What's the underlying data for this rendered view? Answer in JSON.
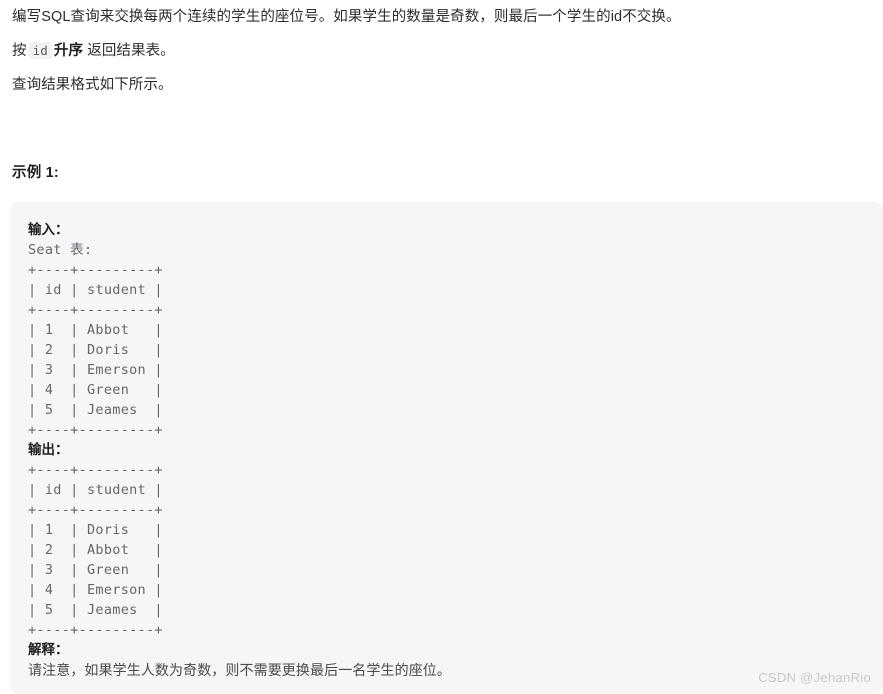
{
  "problem": {
    "paragraph_1": "编写SQL查询来交换每两个连续的学生的座位号。如果学生的数量是奇数，则最后一个学生的id不交换。",
    "paragraph_2": {
      "prefix": "按",
      "code": "id",
      "emphasis": "升序",
      "suffix": "返回结果表。"
    },
    "paragraph_3": "查询结果格式如下所示。"
  },
  "example": {
    "heading": "示例 1:",
    "input_label": "输入：",
    "input_table_caption": "Seat 表:",
    "input_table_text": "+----+---------+\n| id | student |\n+----+---------+\n| 1  | Abbot   |\n| 2  | Doris   |\n| 3  | Emerson |\n| 4  | Green   |\n| 5  | Jeames  |\n+----+---------+",
    "output_label": "输出：",
    "output_table_text": "+----+---------+\n| id | student |\n+----+---------+\n| 1  | Doris   |\n| 2  | Abbot   |\n| 3  | Green   |\n| 4  | Emerson |\n| 5  | Jeames  |\n+----+---------+",
    "explain_label": "解释：",
    "explain_text": "请注意，如果学生人数为奇数，则不需要更换最后一名学生的座位。",
    "input_table": {
      "columns": [
        "id",
        "student"
      ],
      "rows": [
        [
          "1",
          "Abbot"
        ],
        [
          "2",
          "Doris"
        ],
        [
          "3",
          "Emerson"
        ],
        [
          "4",
          "Green"
        ],
        [
          "5",
          "Jeames"
        ]
      ]
    },
    "output_table": {
      "columns": [
        "id",
        "student"
      ],
      "rows": [
        [
          "1",
          "Doris"
        ],
        [
          "2",
          "Abbot"
        ],
        [
          "3",
          "Green"
        ],
        [
          "4",
          "Emerson"
        ],
        [
          "5",
          "Jeames"
        ]
      ]
    }
  },
  "watermark": "CSDN @JehanRio",
  "colors": {
    "page_background": "#ffffff",
    "code_block_background": "#f6f6f6",
    "code_text": "#63686e",
    "body_text": "#2c2c2c",
    "heading_text": "#1f1f1f",
    "inline_code_background": "#f2f2f2",
    "watermark_text": "#c9c9c9"
  }
}
